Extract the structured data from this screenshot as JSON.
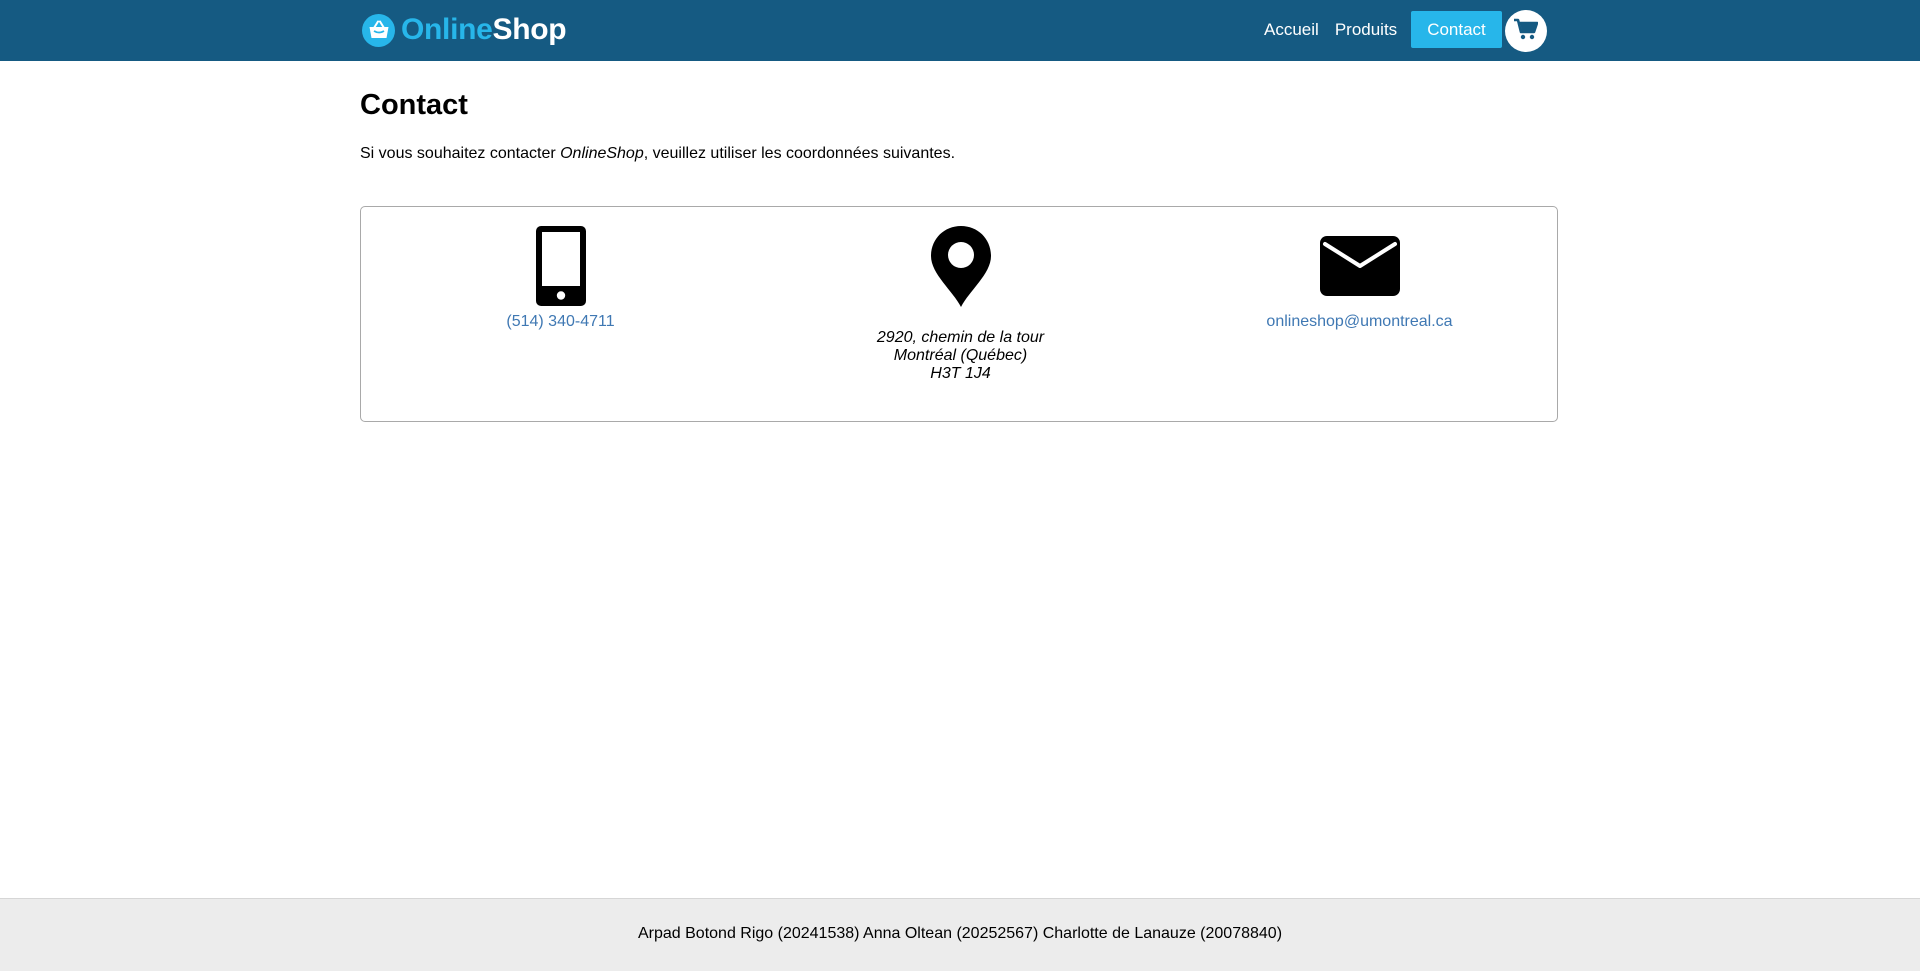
{
  "header": {
    "logo": {
      "online": "Online",
      "shop": "Shop"
    },
    "nav": {
      "home": "Accueil",
      "products": "Produits",
      "contact": "Contact"
    },
    "cart_icon": "shopping-cart-icon",
    "colors": {
      "bar": "#155a82",
      "accent": "#27b6ea"
    }
  },
  "main": {
    "title": "Contact",
    "intro": {
      "before": "Si vous souhaitez contacter ",
      "brand": "OnlineShop",
      "after": ", veuillez utiliser les coordonnées suivantes."
    },
    "contacts": {
      "phone": {
        "icon": "mobile-phone-icon",
        "text": "(514) 340-4711"
      },
      "address": {
        "icon": "map-marker-icon",
        "line1": "2920, chemin de la tour",
        "line2": "Montréal (Québec)",
        "line3": "H3T 1J4"
      },
      "email": {
        "icon": "envelope-icon",
        "text": "onlineshop@umontreal.ca"
      }
    }
  },
  "footer": {
    "text": "Arpad Botond Rigo (20241538) Anna Oltean (20252567) Charlotte de Lanauze (20078840)"
  }
}
